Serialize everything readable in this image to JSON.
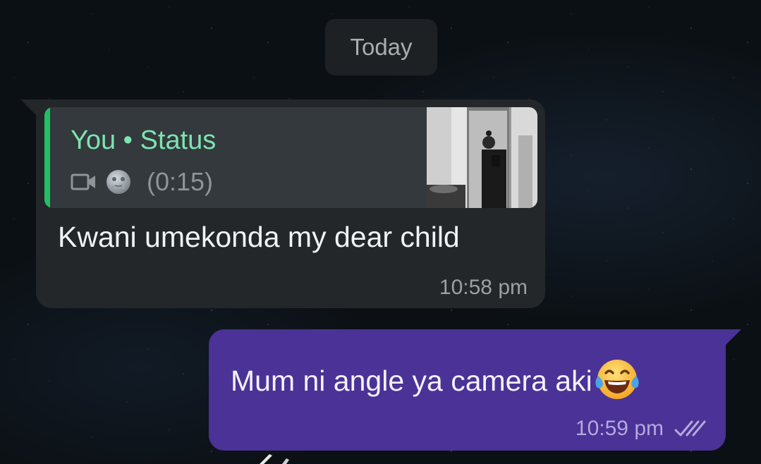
{
  "chat": {
    "date_label": "Today",
    "incoming": {
      "reply": {
        "author": "You • Status",
        "media_icon": "video-camera-icon",
        "emoji": "new-moon-face-emoji",
        "duration": "(0:15)",
        "thumbnail": "status-photo-thumbnail"
      },
      "text": "Kwani umekonda my dear child",
      "time": "10:58 pm"
    },
    "outgoing": {
      "text": "Mum ni angle ya camera aki",
      "emoji": "face-with-tears-of-joy-emoji",
      "time": "10:59 pm",
      "status_icon": "double-check-icon"
    }
  },
  "colors": {
    "background": "#0b1014",
    "incoming_bubble": "#23272a",
    "reply_card": "#33393c",
    "reply_accent": "#21c063",
    "reply_author": "#7ee3b0",
    "outgoing_bubble": "#4a3297"
  }
}
